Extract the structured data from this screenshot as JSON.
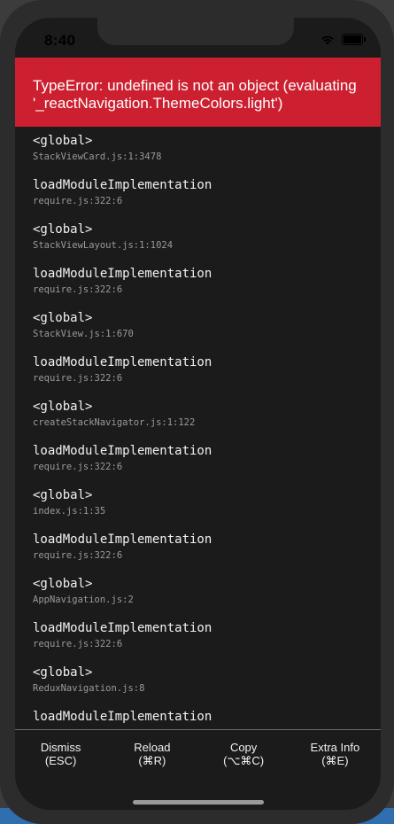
{
  "status_bar": {
    "time": "8:40",
    "icons": [
      "wifi-icon",
      "battery-icon"
    ]
  },
  "error": {
    "message": "TypeError: undefined is not an object (evaluating '_reactNavigation.ThemeColors.light')",
    "background_color": "#cc2030"
  },
  "stack_frames": [
    {
      "fn": "<global>",
      "file": "StackViewCard.js:1:3478"
    },
    {
      "fn": "loadModuleImplementation",
      "file": "require.js:322:6"
    },
    {
      "fn": "<global>",
      "file": "StackViewLayout.js:1:1024"
    },
    {
      "fn": "loadModuleImplementation",
      "file": "require.js:322:6"
    },
    {
      "fn": "<global>",
      "file": "StackView.js:1:670"
    },
    {
      "fn": "loadModuleImplementation",
      "file": "require.js:322:6"
    },
    {
      "fn": "<global>",
      "file": "createStackNavigator.js:1:122"
    },
    {
      "fn": "loadModuleImplementation",
      "file": "require.js:322:6"
    },
    {
      "fn": "<global>",
      "file": "index.js:1:35"
    },
    {
      "fn": "loadModuleImplementation",
      "file": "require.js:322:6"
    },
    {
      "fn": "<global>",
      "file": "AppNavigation.js:2"
    },
    {
      "fn": "loadModuleImplementation",
      "file": "require.js:322:6"
    },
    {
      "fn": "<global>",
      "file": "ReduxNavigation.js:8"
    },
    {
      "fn": "loadModuleImplementation",
      "file": ""
    }
  ],
  "actions": [
    {
      "label": "Dismiss",
      "shortcut": "(ESC)"
    },
    {
      "label": "Reload",
      "shortcut": "(⌘R)"
    },
    {
      "label": "Copy",
      "shortcut": "(⌥⌘C)"
    },
    {
      "label": "Extra Info",
      "shortcut": "(⌘E)"
    }
  ]
}
